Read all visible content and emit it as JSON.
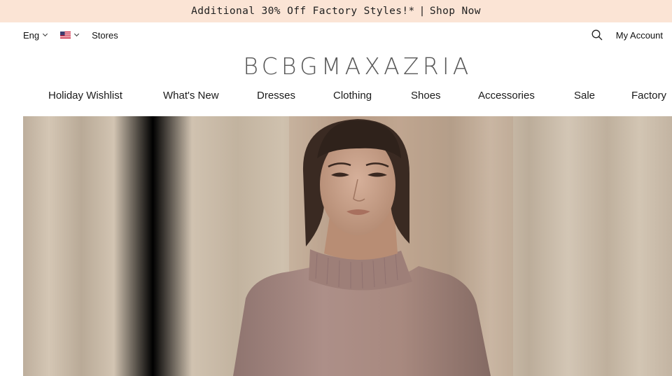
{
  "promo": {
    "text": "Additional 30% Off Factory Styles!*",
    "separator": "|",
    "link": "Shop Now"
  },
  "utility": {
    "language": "Eng",
    "country_flag": "us-flag-icon",
    "stores": "Stores",
    "search_icon": "search-icon",
    "account": "My Account"
  },
  "logo": {
    "text": "BCBGMAXAZRIA"
  },
  "nav": {
    "items": [
      {
        "label": "Holiday Wishlist"
      },
      {
        "label": "What's New"
      },
      {
        "label": "Dresses"
      },
      {
        "label": "Clothing"
      },
      {
        "label": "Shoes"
      },
      {
        "label": "Accessories"
      },
      {
        "label": "Sale"
      },
      {
        "label": "Factory"
      }
    ]
  },
  "hero": {
    "image": "model-in-pink-turtleneck-sweater-photo",
    "colors": {
      "curtain": "#c8b9a6",
      "sweater": "#a88a84",
      "hair": "#3a2a22",
      "skin": "#c9a188"
    }
  }
}
